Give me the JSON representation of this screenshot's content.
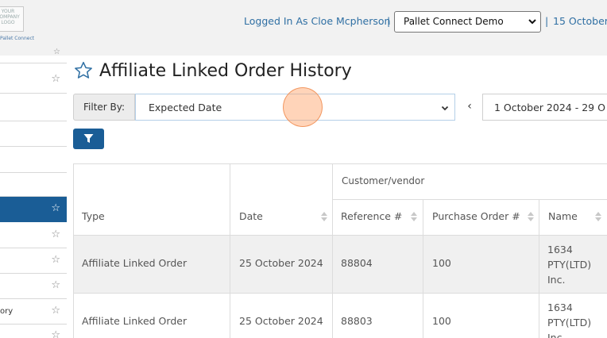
{
  "header": {
    "logo_text": "YOUR COMPANY LOGO",
    "logo_subtext": "Pallet Connect",
    "logged_in_label": "Logged In As Cloe Mcpherson",
    "separator": "|",
    "org_selected": "Pallet Connect Demo",
    "date": "15 October"
  },
  "sidebar": {
    "items": [
      {
        "label": ""
      },
      {
        "label": ""
      },
      {
        "label": ""
      },
      {
        "label": ""
      },
      {
        "label": ""
      },
      {
        "label": ""
      },
      {
        "label": ""
      },
      {
        "label": ""
      },
      {
        "label": "ory"
      },
      {
        "label": ""
      }
    ]
  },
  "main": {
    "title": "Affiliate Linked Order History",
    "filter": {
      "label": "Filter By:",
      "selected": "Expected Date",
      "prev_symbol": "‹",
      "range": "1 October 2024 - 29 O"
    }
  },
  "table": {
    "group_header": "Customer/vendor",
    "columns": [
      "Type",
      "Date",
      "Reference #",
      "Purchase Order #",
      "Name"
    ],
    "rows": [
      {
        "type": "Affiliate Linked Order",
        "date": "25 October 2024",
        "reference": "88804",
        "po": "100",
        "name": [
          "1634",
          "PTY(LTD)",
          "Inc."
        ]
      },
      {
        "type": "Affiliate Linked Order",
        "date": "25 October 2024",
        "reference": "88803",
        "po": "100",
        "name": [
          "1634",
          "PTY(LTD)",
          "Inc."
        ]
      }
    ]
  },
  "colors": {
    "accent": "#1a5d96",
    "link": "#2f6fa3",
    "header_bg": "#f2f2f2",
    "row_stripe": "#f0f0f0"
  },
  "icons": [
    "star-outline-icon",
    "chevron-down-icon",
    "filter-funnel-icon",
    "sort-arrows-icon",
    "chevron-left-icon"
  ]
}
